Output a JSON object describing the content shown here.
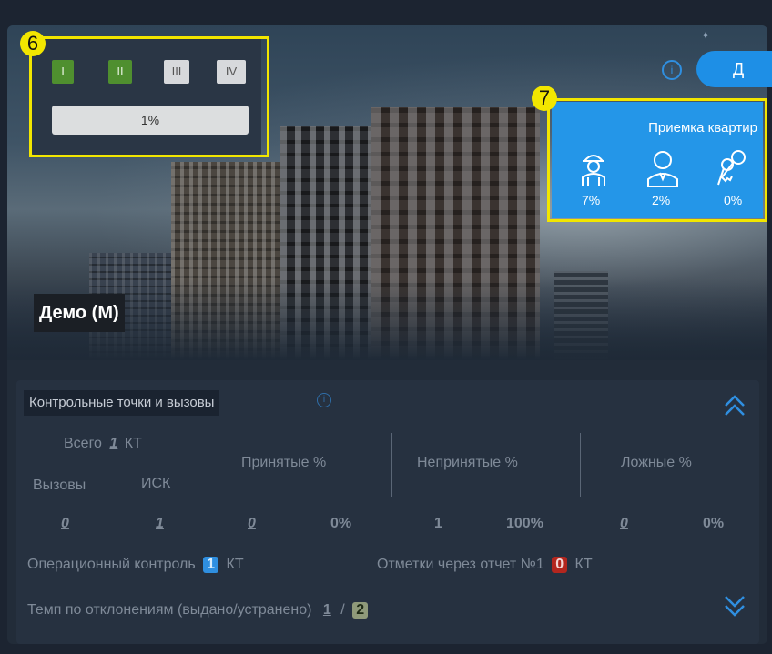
{
  "project": {
    "title": "Демо (М)"
  },
  "stages": {
    "items": [
      {
        "label": "I",
        "active": true
      },
      {
        "label": "II",
        "active": true
      },
      {
        "label": "III",
        "active": false
      },
      {
        "label": "IV",
        "active": false
      }
    ],
    "progress_text": "1%",
    "progress_value": 0.01
  },
  "markers": {
    "stage": "6",
    "acceptance": "7"
  },
  "header_button": {
    "label": "Д"
  },
  "acceptance": {
    "title": "Приемка квартир",
    "items": [
      {
        "icon": "builder-icon",
        "pct": "7%"
      },
      {
        "icon": "manager-icon",
        "pct": "2%"
      },
      {
        "icon": "keys-icon",
        "pct": "0%"
      }
    ]
  },
  "checkpoints": {
    "title": "Контрольные точки и вызовы",
    "total_label": "Всего",
    "total_value": "1",
    "total_unit": "КТ",
    "calls_label": "Вызовы",
    "isk_label": "ИСК",
    "accepted_label": "Принятые %",
    "unaccepted_label": "Непринятые %",
    "false_label": "Ложные %",
    "calls_value": "0",
    "isk_value": "1",
    "accepted_count": "0",
    "accepted_pct": "0%",
    "unaccepted_count": "1",
    "unaccepted_pct": "100%",
    "false_count": "0",
    "false_pct": "0%",
    "op_control_label": "Операционный контроль",
    "op_control_value": "1",
    "op_control_unit": "КТ",
    "report_label": "Отметки через отчет №1",
    "report_value": "0",
    "report_unit": "КТ",
    "tempo_label": "Темп по отклонениям (выдано/устранено)",
    "tempo_issued": "1",
    "tempo_sep": "/",
    "tempo_fixed": "2"
  },
  "colors": {
    "accent": "#2496e8",
    "stage_active": "#4f8f2f",
    "highlight": "#f2e600",
    "report_badge": "#b3261e"
  }
}
